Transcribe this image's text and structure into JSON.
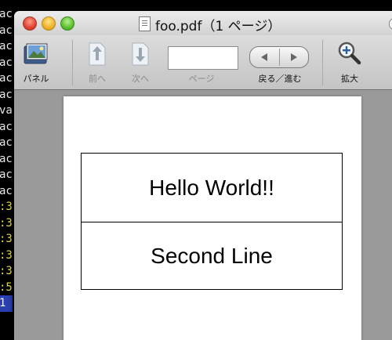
{
  "terminal": {
    "lines": [
      {
        "text": "ac",
        "color": "white"
      },
      {
        "text": "ac",
        "color": "white"
      },
      {
        "text": "ac",
        "color": "white"
      },
      {
        "text": "ac",
        "color": "white"
      },
      {
        "text": "ac",
        "color": "white"
      },
      {
        "text": "ac",
        "color": "white"
      },
      {
        "text": "va",
        "color": "white"
      },
      {
        "text": "ac",
        "color": "white"
      },
      {
        "text": "ac",
        "color": "white"
      },
      {
        "text": "ac",
        "color": "white"
      },
      {
        "text": "ac",
        "color": "white"
      },
      {
        "text": "ac",
        "color": "white"
      },
      {
        "text": ":3",
        "color": "yellow"
      },
      {
        "text": ":3",
        "color": "yellow"
      },
      {
        "text": ":3",
        "color": "yellow"
      },
      {
        "text": ":3",
        "color": "yellow"
      },
      {
        "text": ":3",
        "color": "yellow"
      },
      {
        "text": ":5",
        "color": "yellow"
      },
      {
        "text": "1",
        "color": "blue"
      }
    ]
  },
  "window": {
    "title": "foo.pdf（1 ページ）"
  },
  "toolbar": {
    "panel_label": "パネル",
    "prev_label": "前へ",
    "next_label": "次へ",
    "page_label": "ページ",
    "page_value": "",
    "back_forward_label": "戻る／進む",
    "zoom_label": "拡大"
  },
  "document": {
    "line1": "Hello World!!",
    "line2": "Second Line"
  },
  "colors": {
    "workspace_gray": "#9a9a9a",
    "terminal_yellow": "#e6d94a",
    "terminal_blue": "#2a3fb0"
  }
}
